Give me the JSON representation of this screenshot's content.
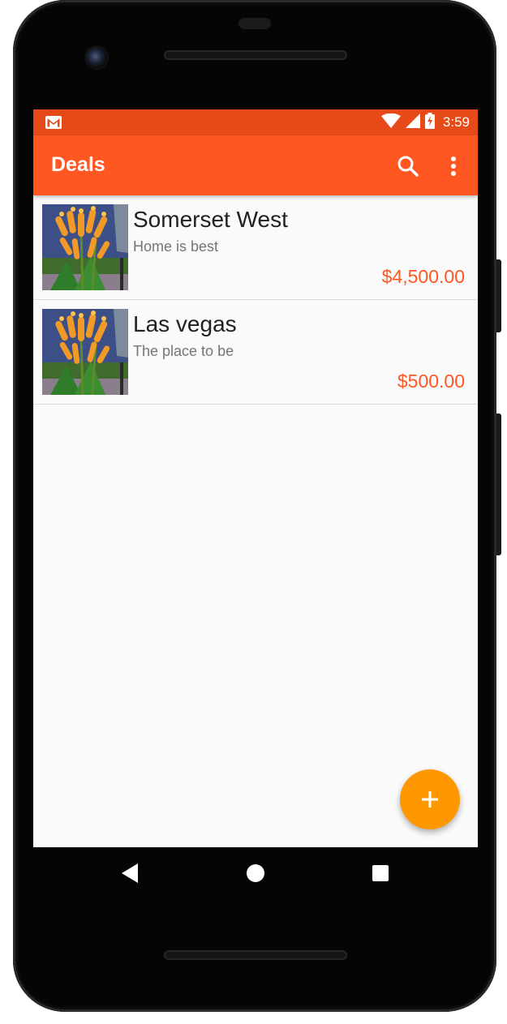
{
  "status_bar": {
    "time": "3:59",
    "icons": [
      "gmail-icon",
      "wifi-icon",
      "cellular-signal-icon",
      "battery-charging-icon"
    ]
  },
  "app_bar": {
    "title": "Deals",
    "actions": [
      "search-icon",
      "more-vert-icon"
    ]
  },
  "deals": [
    {
      "title": "Somerset West",
      "description": "Home is best",
      "price": "$4,500.00",
      "thumbnail": "flower-photo"
    },
    {
      "title": "Las vegas",
      "description": "The place to be",
      "price": "$500.00",
      "thumbnail": "flower-photo"
    }
  ],
  "fab": {
    "icon": "add-icon"
  },
  "navigation_bar": {
    "icons": [
      "back-icon",
      "home-icon",
      "recents-icon"
    ]
  },
  "colors": {
    "status_bar": "#e64a19",
    "app_bar": "#ff5722",
    "price_text": "#ff5722",
    "fab": "#ff9800",
    "list_background": "#fafafa"
  }
}
